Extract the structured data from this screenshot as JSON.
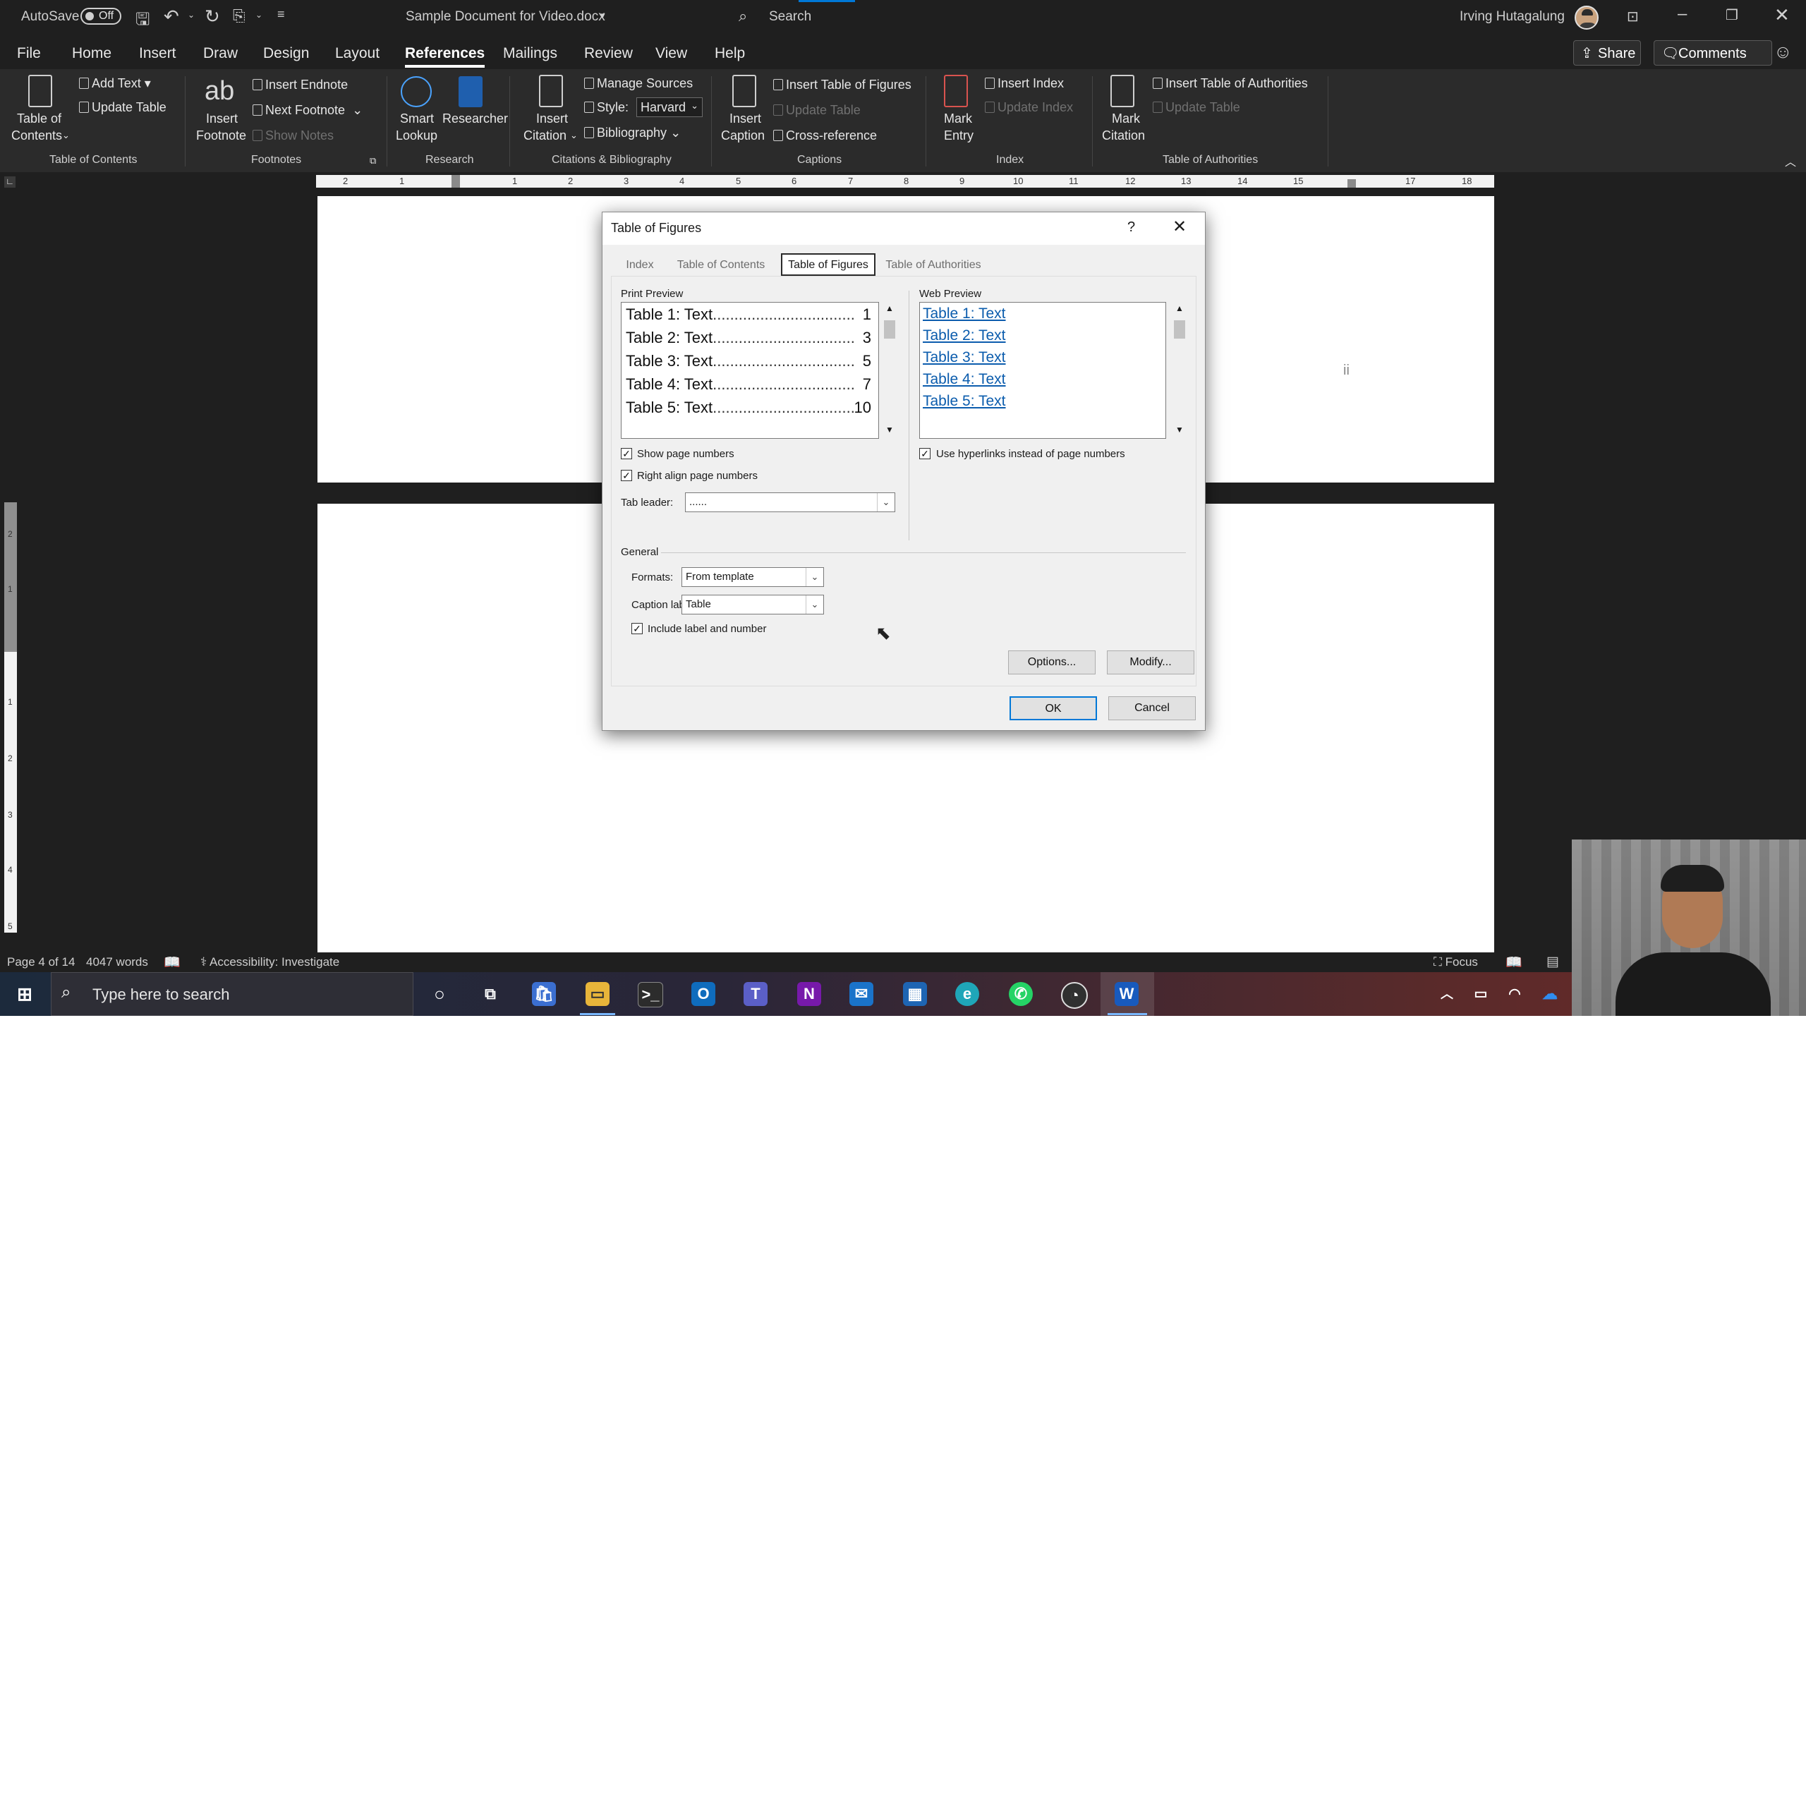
{
  "titlebar": {
    "autosave_label": "AutoSave",
    "autosave_state": "Off",
    "doc_title": "Sample Document for Video.docx",
    "search_label": "Search",
    "user_name": "Irving Hutagalung"
  },
  "menu": {
    "tabs": [
      "File",
      "Home",
      "Insert",
      "Draw",
      "Design",
      "Layout",
      "References",
      "Mailings",
      "Review",
      "View",
      "Help"
    ],
    "active": "References",
    "share_label": "Share",
    "comments_label": "Comments"
  },
  "ribbon": {
    "toc": {
      "btn_line1": "Table of",
      "btn_line2": "Contents",
      "add_text": "Add Text",
      "update_table": "Update Table",
      "group": "Table of Contents"
    },
    "footnotes": {
      "insert_footnote_1": "Insert",
      "insert_footnote_2": "Footnote",
      "insert_endnote": "Insert Endnote",
      "next_footnote": "Next Footnote",
      "show_notes": "Show Notes",
      "group": "Footnotes",
      "ab_glyph": "ab"
    },
    "research": {
      "smart_lookup_1": "Smart",
      "smart_lookup_2": "Lookup",
      "researcher": "Researcher",
      "group": "Research"
    },
    "citations": {
      "insert_citation_1": "Insert",
      "insert_citation_2": "Citation",
      "manage_sources": "Manage Sources",
      "style_label": "Style:",
      "style_value": "Harvard",
      "bibliography": "Bibliography",
      "group": "Citations & Bibliography"
    },
    "captions": {
      "insert_caption_1": "Insert",
      "insert_caption_2": "Caption",
      "insert_tof": "Insert Table of Figures",
      "update_table": "Update Table",
      "cross_reference": "Cross-reference",
      "group": "Captions"
    },
    "index": {
      "mark_entry_1": "Mark",
      "mark_entry_2": "Entry",
      "insert_index": "Insert Index",
      "update_index": "Update Index",
      "group": "Index"
    },
    "toa": {
      "mark_citation_1": "Mark",
      "mark_citation_2": "Citation",
      "insert_toa": "Insert Table of Authorities",
      "update_table": "Update Table",
      "group": "Table of Authorities"
    }
  },
  "ruler": {
    "h_marks": [
      "2",
      "1",
      "1",
      "2",
      "3",
      "4",
      "5",
      "6",
      "7",
      "8",
      "9",
      "10",
      "11",
      "12",
      "13",
      "14",
      "15",
      "17",
      "18"
    ],
    "v_marks": [
      "2",
      "1",
      "1",
      "2",
      "3",
      "4",
      "5"
    ]
  },
  "document": {
    "page_number_marker": "ii"
  },
  "dialog": {
    "title": "Table of Figures",
    "help": "?",
    "tabs": [
      "Index",
      "Table of Contents",
      "Table of Figures",
      "Table of Authorities"
    ],
    "selected_tab": "Table of Figures",
    "print_preview_label": "Print Preview",
    "print_preview_rows": [
      {
        "label": "Table 1: Text",
        "page": "1"
      },
      {
        "label": "Table 2: Text",
        "page": "3"
      },
      {
        "label": "Table 3: Text",
        "page": "5"
      },
      {
        "label": "Table 4: Text",
        "page": "7"
      },
      {
        "label": "Table 5: Text",
        "page": "10"
      }
    ],
    "web_preview_label": "Web Preview",
    "web_preview_rows": [
      "Table 1: Text",
      "Table 2: Text",
      "Table 3: Text",
      "Table 4: Text",
      "Table 5: Text"
    ],
    "show_page_numbers": {
      "label": "Show page numbers",
      "checked": true
    },
    "right_align": {
      "label": "Right align page numbers",
      "checked": true
    },
    "use_hyperlinks": {
      "label": "Use hyperlinks instead of page numbers",
      "checked": true
    },
    "tab_leader_label": "Tab leader:",
    "tab_leader_value": "......",
    "general_label": "General",
    "formats_label": "Formats:",
    "formats_value": "From template",
    "caption_label_label": "Caption label:",
    "caption_label_value": "Table",
    "include_label": {
      "label": "Include label and number",
      "checked": true
    },
    "options_btn": "Options...",
    "modify_btn": "Modify...",
    "ok_btn": "OK",
    "cancel_btn": "Cancel"
  },
  "status": {
    "page": "Page 4 of 14",
    "words": "4047 words",
    "accessibility": "Accessibility: Investigate",
    "focus": "Focus"
  },
  "taskbar": {
    "search_placeholder": "Type here to search",
    "apps": [
      "cortana-icon",
      "task-view-icon",
      "store-icon",
      "file-explorer-icon",
      "terminal-icon",
      "outlook-icon",
      "teams-icon",
      "onenote-icon",
      "mail-icon",
      "app-icon",
      "edge-icon",
      "whatsapp-icon",
      "obs-icon",
      "word-icon"
    ]
  },
  "colors": {
    "accent": "#0078d7",
    "titlebar_bg": "#1f1f1f",
    "ribbon_bg": "#2b2b2b",
    "link": "#0b5cad"
  }
}
